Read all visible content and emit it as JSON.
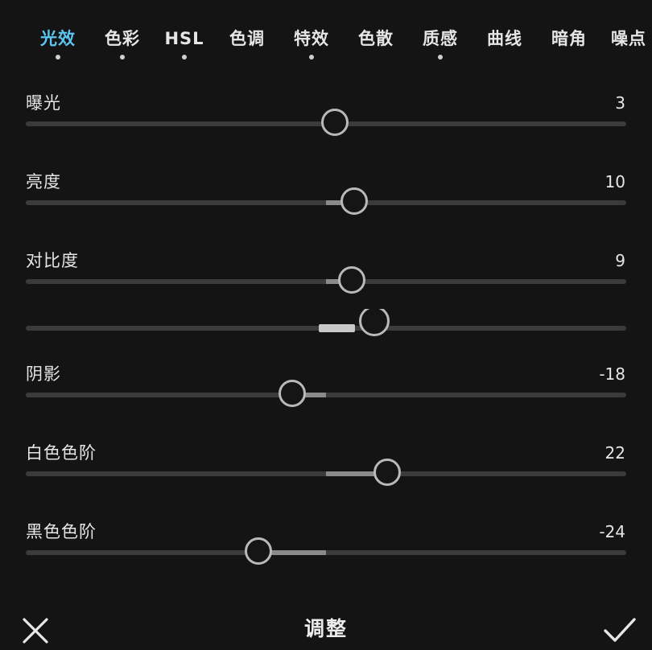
{
  "tabs": [
    {
      "label": "光效",
      "active": true,
      "dot": true
    },
    {
      "label": "色彩",
      "active": false,
      "dot": true
    },
    {
      "label": "HSL",
      "active": false,
      "dot": true
    },
    {
      "label": "色调",
      "active": false,
      "dot": false
    },
    {
      "label": "特效",
      "active": false,
      "dot": true
    },
    {
      "label": "色散",
      "active": false,
      "dot": false
    },
    {
      "label": "质感",
      "active": false,
      "dot": true
    },
    {
      "label": "曲线",
      "active": false,
      "dot": false
    },
    {
      "label": "暗角",
      "active": false,
      "dot": false
    },
    {
      "label": "噪点",
      "active": false,
      "dot": false
    }
  ],
  "sliders": [
    {
      "label": "曝光",
      "value": "3"
    },
    {
      "label": "亮度",
      "value": "10"
    },
    {
      "label": "对比度",
      "value": "9"
    },
    {
      "label": "阴影",
      "value": "-18"
    },
    {
      "label": "白色色阶",
      "value": "22"
    },
    {
      "label": "黑色色阶",
      "value": "-24"
    }
  ],
  "bottom": {
    "title": "调整",
    "close_icon": "close-icon",
    "confirm_icon": "checkmark-icon"
  },
  "colors": {
    "accent": "#5cc6f2",
    "background": "#141414"
  }
}
